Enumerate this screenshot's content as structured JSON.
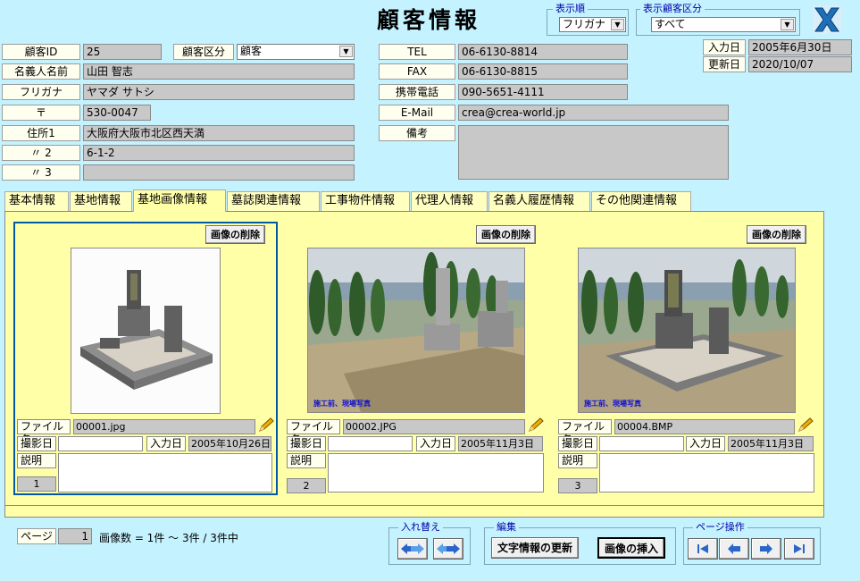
{
  "header": {
    "title": "顧客情報",
    "sort_label": "表示順",
    "sort_value": "フリガナ",
    "filter_label": "表示顧客区分",
    "filter_value": "すべて"
  },
  "customer": {
    "id_label": "顧客ID",
    "id_value": "25",
    "category_label": "顧客区分",
    "category_value": "顧客",
    "name_label": "名義人名前",
    "name_value": "山田 智志",
    "kana_label": "フリガナ",
    "kana_value": "ヤマダ サトシ",
    "zip_label": "〒",
    "zip_value": "530-0047",
    "addr1_label": "住所1",
    "addr1_value": "大阪府大阪市北区西天満",
    "addr2_label": "〃 2",
    "addr2_value": "6-1-2",
    "addr3_label": "〃 3",
    "addr3_value": "",
    "tel_label": "TEL",
    "tel_value": "06-6130-8814",
    "fax_label": "FAX",
    "fax_value": "06-6130-8815",
    "mobile_label": "携帯電話",
    "mobile_value": "090-5651-4111",
    "email_label": "E-Mail",
    "email_value": "crea@crea-world.jp",
    "note_label": "備考",
    "note_value": "",
    "entry_label": "入力日",
    "entry_value": "2005年6月30日",
    "update_label": "更新日",
    "update_value": "2020/10/07"
  },
  "tabs": [
    {
      "label": "基本情報"
    },
    {
      "label": "基地情報"
    },
    {
      "label": "基地画像情報"
    },
    {
      "label": "墓誌関連情報"
    },
    {
      "label": "工事物件情報"
    },
    {
      "label": "代理人情報"
    },
    {
      "label": "名義人履歴情報"
    },
    {
      "label": "その他関連情報"
    }
  ],
  "active_tab": "基地画像情報",
  "cards": [
    {
      "delete_label": "画像の削除",
      "file_label": "ファイル名",
      "file_value": "00001.jpg",
      "shot_label": "撮影日",
      "shot_value": "",
      "entry_label": "入力日",
      "entry_value": "2005年10月26日",
      "desc_label": "説明",
      "number": "1",
      "caption": ""
    },
    {
      "delete_label": "画像の削除",
      "file_label": "ファイル名",
      "file_value": "00002.JPG",
      "shot_label": "撮影日",
      "shot_value": "",
      "entry_label": "入力日",
      "entry_value": "2005年11月3日",
      "desc_label": "説明",
      "number": "2",
      "caption": "施工前、現場写真"
    },
    {
      "delete_label": "画像の削除",
      "file_label": "ファイル名",
      "file_value": "00004.BMP",
      "shot_label": "撮影日",
      "shot_value": "",
      "entry_label": "入力日",
      "entry_value": "2005年11月3日",
      "desc_label": "説明",
      "number": "3",
      "caption": "施工前、現場写真"
    }
  ],
  "footer": {
    "page_label": "ページ",
    "page_value": "1",
    "count_text": "画像数 = 1件 ～ 3件 / 3件中",
    "swap_label": "入れ替え",
    "edit_label": "編集",
    "update_text_btn": "文字情報の更新",
    "insert_btn": "画像の挿入",
    "page_ops_label": "ページ操作"
  },
  "colors": {
    "background": "#c4f3ff",
    "panel": "#ffffa8",
    "selection": "#0058a8",
    "exit_icon": "#1e6fb8"
  }
}
